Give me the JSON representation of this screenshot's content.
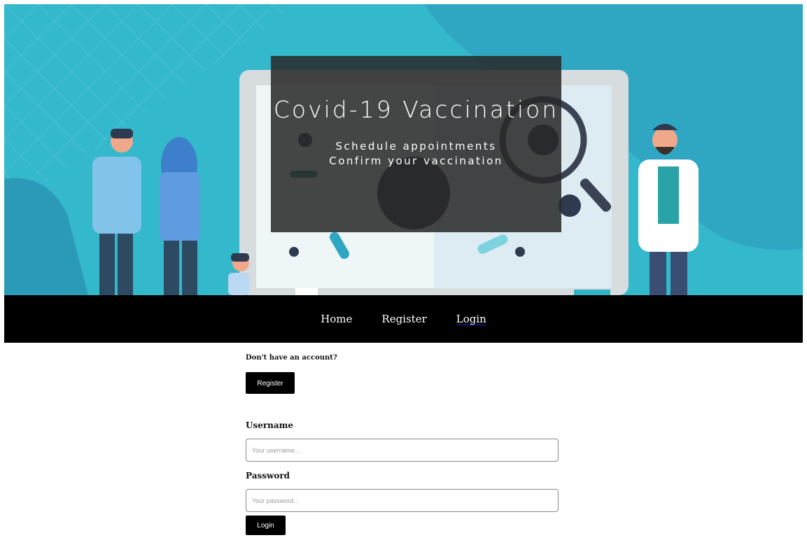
{
  "hero": {
    "title": "Covid-19 Vaccination",
    "subtitle_line1": "Schedule appointments",
    "subtitle_line2": "Confirm your vaccination"
  },
  "nav": {
    "items": [
      {
        "label": "Home",
        "active": false
      },
      {
        "label": "Register",
        "active": false
      },
      {
        "label": "Login",
        "active": true
      }
    ]
  },
  "login": {
    "no_account_text": "Don't have an account?",
    "register_button": "Register",
    "username_label": "Username",
    "username_placeholder": "Your username...",
    "username_value": "",
    "password_label": "Password",
    "password_placeholder": "Your password...",
    "password_value": "",
    "login_button": "Login"
  },
  "colors": {
    "hero_bg": "#34b8cb",
    "navbar_bg": "#000000",
    "button_bg": "#000000",
    "active_underline": "#1a33cc"
  }
}
